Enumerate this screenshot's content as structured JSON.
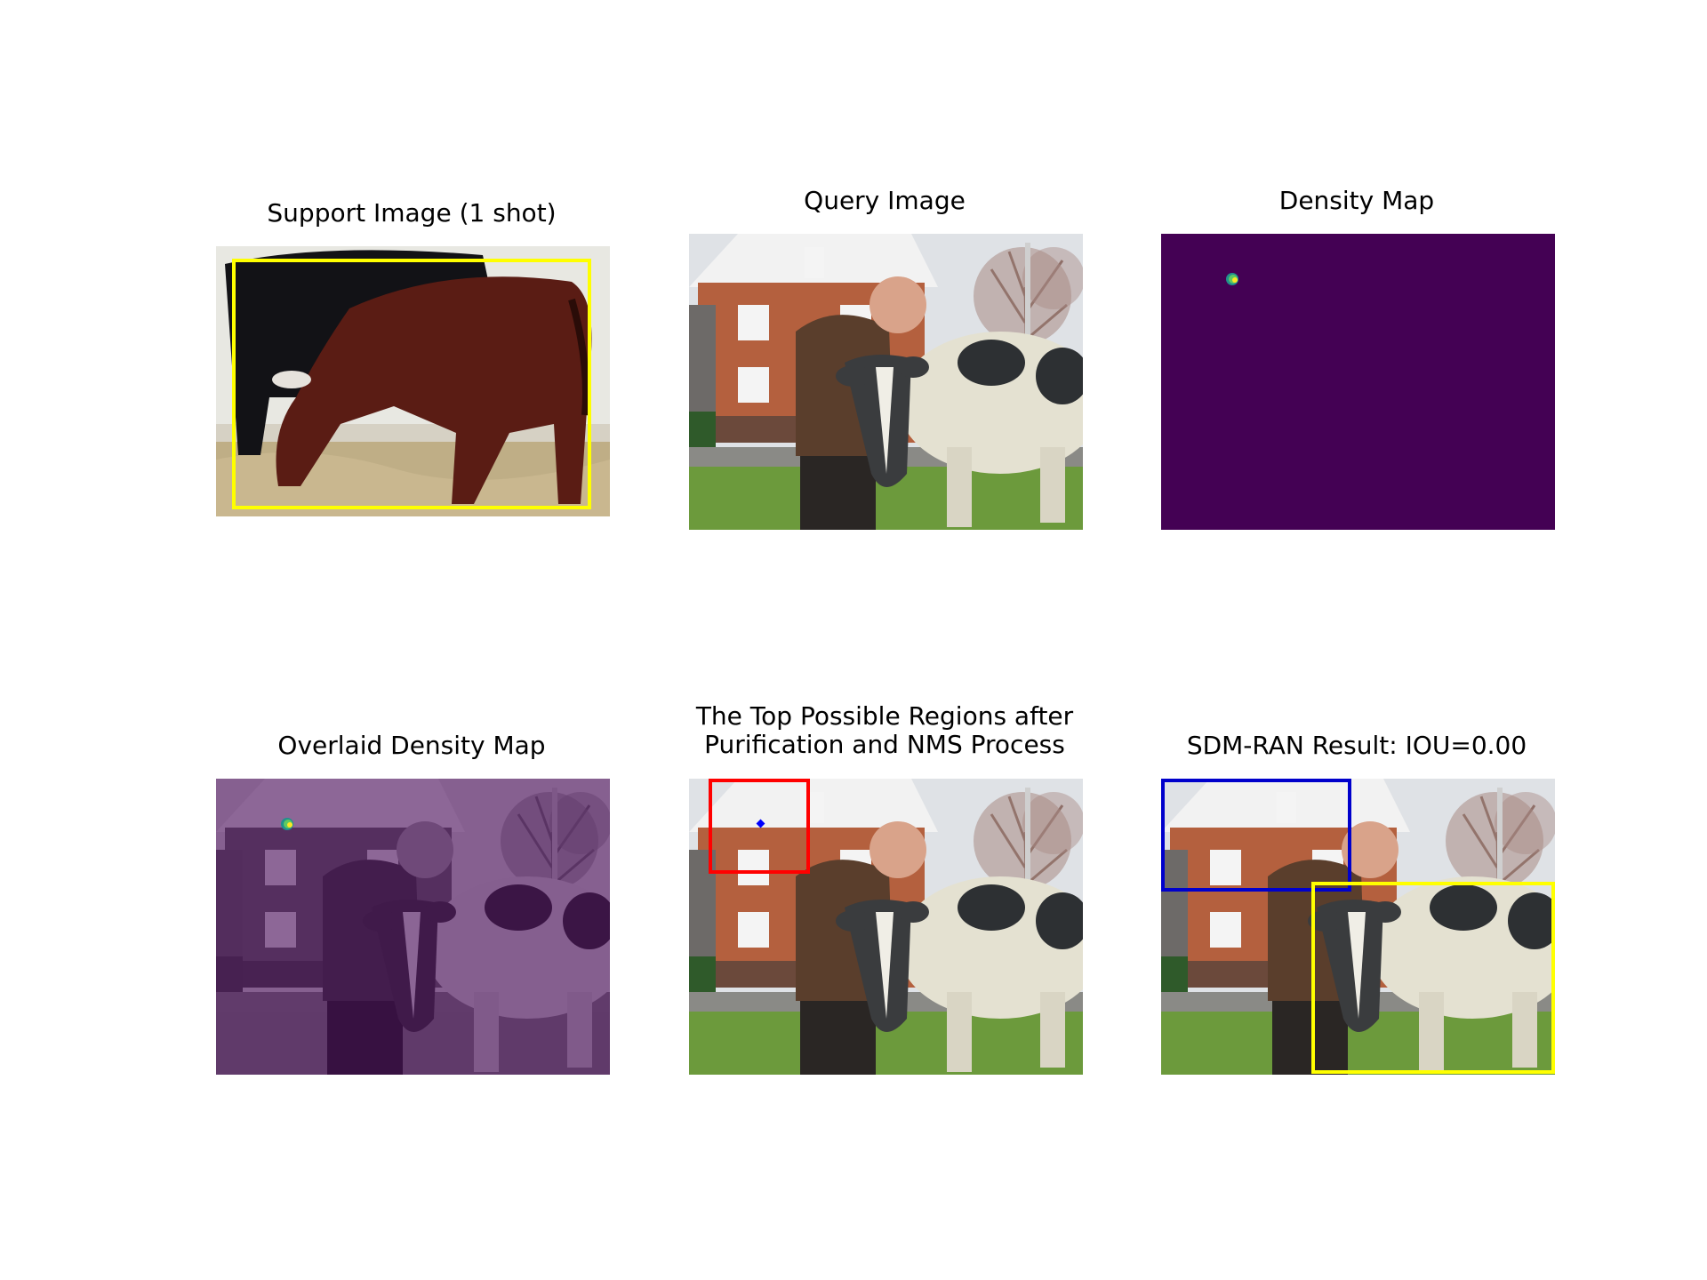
{
  "panels": [
    {
      "title": "Support Image (1 shot)"
    },
    {
      "title": "Query Image"
    },
    {
      "title": "Density Map"
    },
    {
      "title": "Overlaid Density Map"
    },
    {
      "title": "The Top Possible Regions after\nPurification and NMS Process"
    },
    {
      "title": "SDM-RAN Result: IOU=0.00"
    }
  ],
  "colors": {
    "support_box": "#ffff00",
    "density_background": "#440154",
    "density_hotspot": "#5ec962",
    "region_box": "#ff0000",
    "region_point": "#0000ff",
    "prediction_box": "#0000cc",
    "ground_truth_box": "#ffff00"
  }
}
